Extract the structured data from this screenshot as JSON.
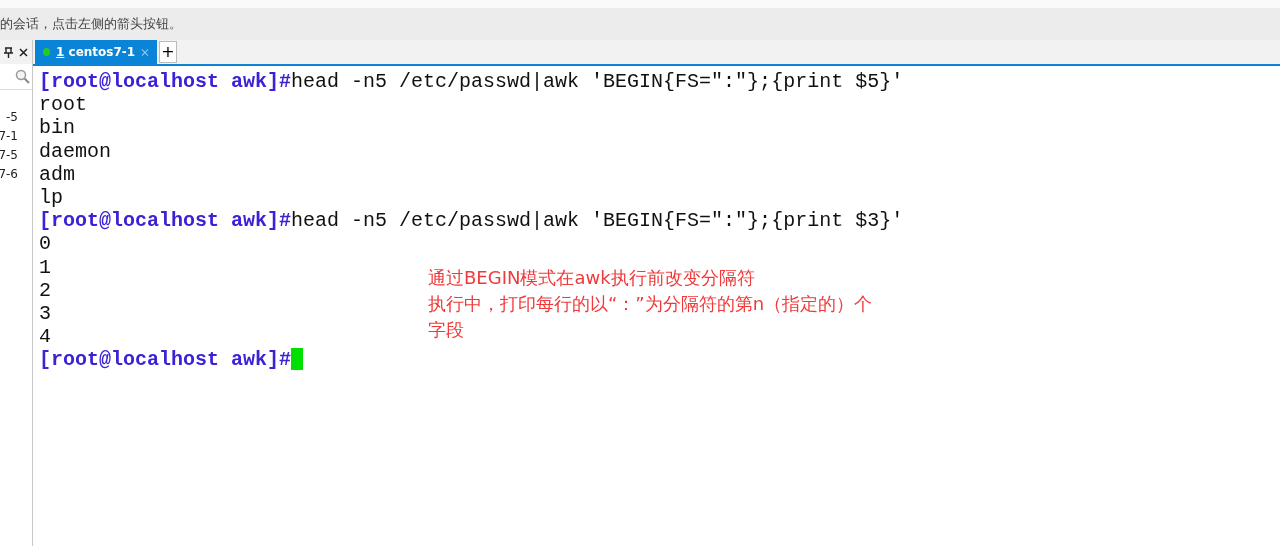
{
  "hint_bar": {
    "text": "的会话，点击左侧的箭头按钮。"
  },
  "sidebar": {
    "items": [
      {
        "label": "-5"
      },
      {
        "label": "7-1"
      },
      {
        "label": "7-5"
      },
      {
        "label": "7-6"
      }
    ]
  },
  "tabs": [
    {
      "number": "1",
      "label": "centos7-1",
      "selected": true,
      "connected": true
    }
  ],
  "new_tab": "+",
  "terminal": {
    "lines": [
      {
        "kind": "command",
        "prompt": "[root@localhost awk]#",
        "command": "head -n5 /etc/passwd|awk 'BEGIN{FS=\":\"};{print $5}'"
      },
      {
        "kind": "output",
        "text": "root"
      },
      {
        "kind": "output",
        "text": "bin"
      },
      {
        "kind": "output",
        "text": "daemon"
      },
      {
        "kind": "output",
        "text": "adm"
      },
      {
        "kind": "output",
        "text": "lp"
      },
      {
        "kind": "command",
        "prompt": "[root@localhost awk]#",
        "command": "head -n5 /etc/passwd|awk 'BEGIN{FS=\":\"};{print $3}'"
      },
      {
        "kind": "output",
        "text": "0"
      },
      {
        "kind": "output",
        "text": "1"
      },
      {
        "kind": "output",
        "text": "2"
      },
      {
        "kind": "output",
        "text": "3"
      },
      {
        "kind": "output",
        "text": "4"
      },
      {
        "kind": "command",
        "prompt": "[root@localhost awk]#",
        "cursor": true
      }
    ]
  },
  "annotation": {
    "lines": [
      "通过BEGIN模式在awk执行前改变分隔符",
      "执行中，打印每行的以“：”为分隔符的第n（指定的）个",
      "字段"
    ]
  }
}
